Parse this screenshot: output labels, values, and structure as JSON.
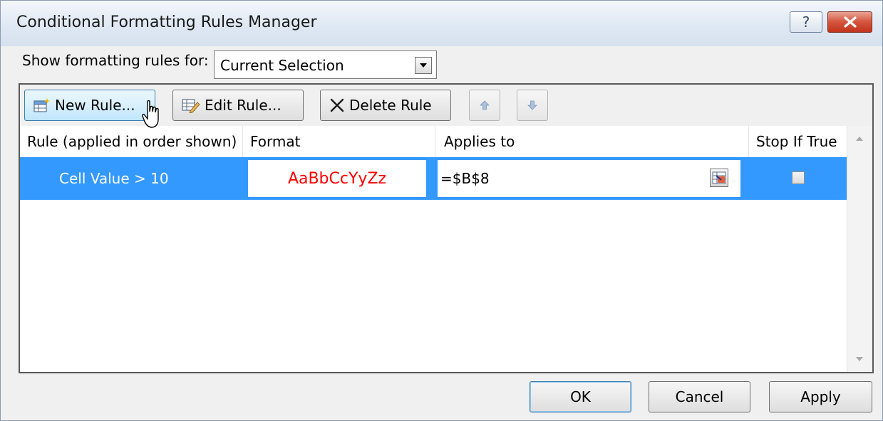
{
  "window": {
    "title": "Conditional Formatting Rules Manager",
    "help_label": "?"
  },
  "filter": {
    "label": "Show formatting rules for:",
    "selected": "Current Selection"
  },
  "toolbar": {
    "new_rule": "New Rule...",
    "edit_rule": "Edit Rule...",
    "delete_rule": "Delete Rule"
  },
  "columns": {
    "rule": "Rule (applied in order shown)",
    "format": "Format",
    "applies_to": "Applies to",
    "stop_if_true": "Stop If True"
  },
  "rules": [
    {
      "rule": "Cell Value > 10",
      "format_preview": "AaBbCcYyZz",
      "format_color": "#ff0000",
      "applies_to": "=$B$8",
      "stop_if_true": false,
      "selected": true
    }
  ],
  "buttons": {
    "ok": "OK",
    "cancel": "Cancel",
    "apply": "Apply"
  },
  "colors": {
    "selection": "#3399ff",
    "close_button": "#c9432a"
  }
}
